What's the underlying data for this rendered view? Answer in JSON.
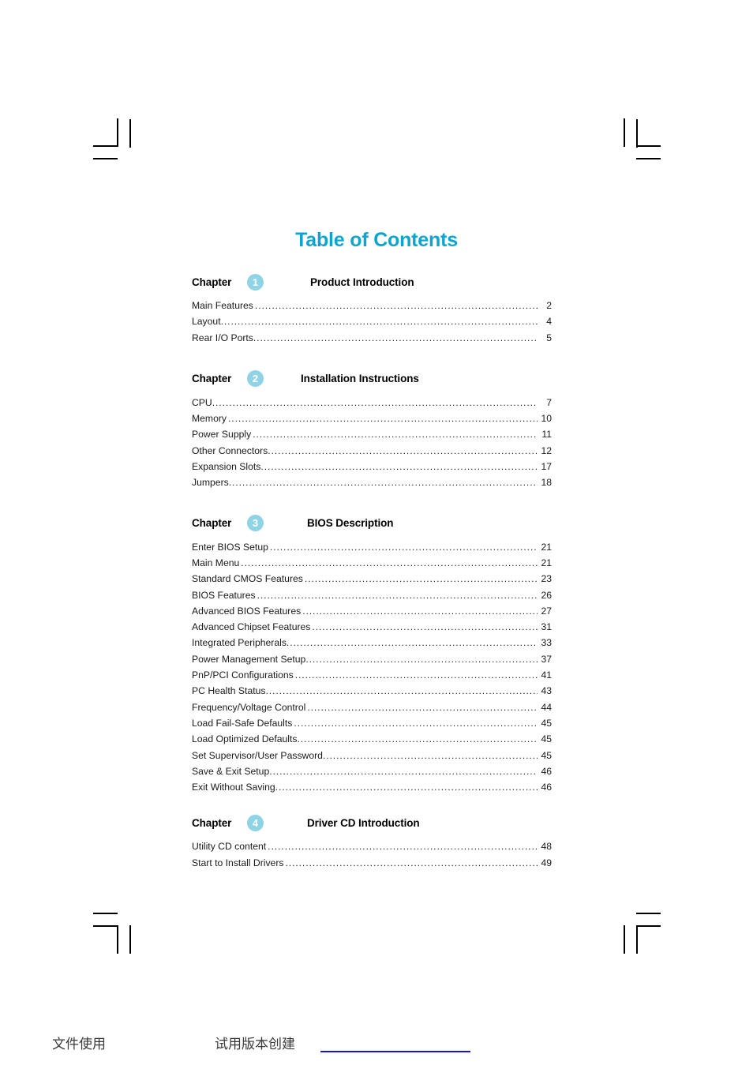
{
  "document": {
    "title": "Table of Contents"
  },
  "chapters": [
    {
      "word": "Chapter",
      "number": "1",
      "title": "Product Introduction",
      "entries": [
        {
          "label": "Main Features",
          "page": "2"
        },
        {
          "label": "Layout",
          "page": "4"
        },
        {
          "label": "Rear I/O Ports",
          "page": "5"
        }
      ]
    },
    {
      "word": "Chapter",
      "number": "2",
      "title": "Installation Instructions",
      "entries": [
        {
          "label": "CPU",
          "page": "7"
        },
        {
          "label": "Memory",
          "page": "10"
        },
        {
          "label": "Power Supply",
          "page": "11"
        },
        {
          "label": "Other Connectors",
          "page": "12"
        },
        {
          "label": "Expansion Slots",
          "page": "17"
        },
        {
          "label": "Jumpers",
          "page": "18"
        }
      ]
    },
    {
      "word": "Chapter",
      "number": "3",
      "title": "BIOS Description",
      "entries": [
        {
          "label": "Enter BIOS Setup",
          "page": "21"
        },
        {
          "label": "Main Menu",
          "page": "21"
        },
        {
          "label": "Standard CMOS Features",
          "page": "23"
        },
        {
          "label": "BIOS Features",
          "page": "26"
        },
        {
          "label": "Advanced BIOS Features",
          "page": "27"
        },
        {
          "label": "Advanced Chipset Features",
          "page": "31"
        },
        {
          "label": "Integrated Peripherals",
          "page": "33"
        },
        {
          "label": "Power Management Setup",
          "page": "37"
        },
        {
          "label": "PnP/PCI Configurations",
          "page": "41"
        },
        {
          "label": "PC Health Status",
          "page": "43"
        },
        {
          "label": "Frequency/Voltage Control",
          "page": "44"
        },
        {
          "label": "Load Fail-Safe Defaults",
          "page": "45"
        },
        {
          "label": "Load Optimized Defaults",
          "page": "45"
        },
        {
          "label": "Set Supervisor/User Password",
          "page": "45"
        },
        {
          "label": "Save & Exit Setup",
          "page": "46"
        },
        {
          "label": "Exit Without Saving",
          "page": "46"
        }
      ]
    },
    {
      "word": "Chapter",
      "number": "4",
      "title": "Driver CD Introduction",
      "entries": [
        {
          "label": "Utility CD content",
          "page": "48"
        },
        {
          "label": "Start to Install Drivers",
          "page": "49"
        }
      ]
    }
  ],
  "footer": {
    "left_text": "文件使用",
    "right_text": "试用版本创建"
  },
  "colors": {
    "title_accent": "#0BA5CE",
    "badge": "#8FD3E6",
    "footer_rule": "#1414D8",
    "text": "#1A1A1A"
  }
}
